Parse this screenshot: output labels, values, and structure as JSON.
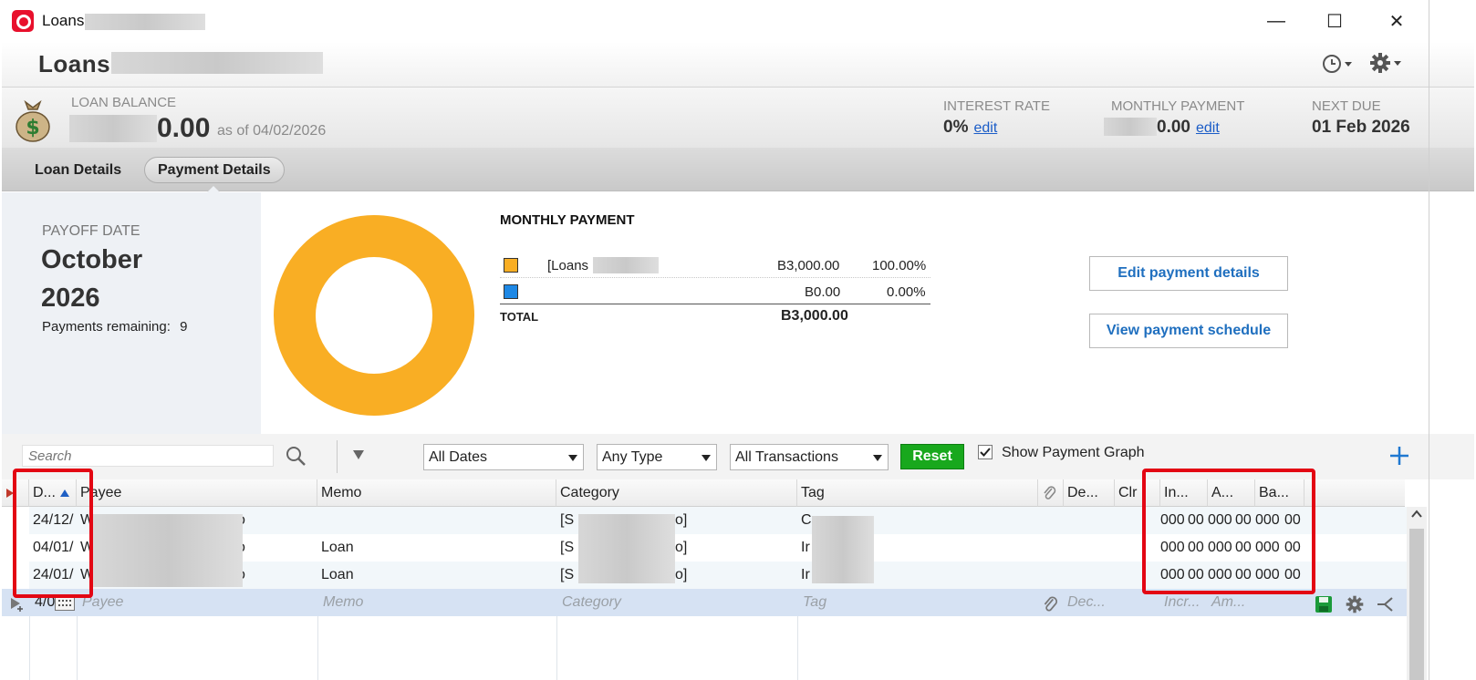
{
  "window": {
    "title": "Loans",
    "minimize_glyph": "—",
    "maximize_glyph": "☐",
    "close_glyph": "✕"
  },
  "header": {
    "title": "Loans",
    "icons": [
      "history-clock-icon",
      "gear-icon"
    ]
  },
  "summary": {
    "balance_label": "LOAN BALANCE",
    "balance_value": "0.00",
    "balance_asof": "as of 04/02/2026",
    "interest_label": "INTEREST RATE",
    "interest_value": "0%",
    "interest_edit": "edit",
    "payment_label": "MONTHLY PAYMENT",
    "payment_value": "0.00",
    "payment_edit": "edit",
    "nextdue_label": "NEXT DUE",
    "nextdue_value": "01 Feb 2026"
  },
  "tabs": [
    {
      "label": "Loan Details",
      "active": false
    },
    {
      "label": "Payment Details",
      "active": true
    }
  ],
  "payoff": {
    "label": "PAYOFF DATE",
    "month": "October",
    "year": "2026",
    "remaining_label": "Payments remaining:",
    "remaining_value": "9"
  },
  "monthly": {
    "title": "MONTHLY PAYMENT",
    "rows": [
      {
        "name": "[Loans",
        "amount": "B3,000.00",
        "percent": "100.00%",
        "color": "#f9ae24"
      },
      {
        "name": "",
        "amount": "B0.00",
        "percent": "0.00%",
        "color": "#1e88e5"
      }
    ],
    "total_label": "TOTAL",
    "total_amount": "B3,000.00"
  },
  "chart_data": {
    "type": "pie",
    "donut": true,
    "slices": [
      {
        "label": "[Loans",
        "value": 100.0,
        "color": "#f9ae24"
      },
      {
        "label": "",
        "value": 0.0,
        "color": "#1e88e5"
      }
    ]
  },
  "buttons": {
    "edit_payment": "Edit payment details",
    "view_schedule": "View payment schedule",
    "reset": "Reset"
  },
  "filters": {
    "search_placeholder": "Search",
    "dates": "All Dates",
    "type": "Any Type",
    "transactions": "All Transactions",
    "show_graph_label": "Show Payment Graph",
    "show_graph_checked": true
  },
  "register": {
    "columns": [
      "D...",
      "Payee",
      "Memo",
      "Category",
      "Tag",
      "De...",
      "Clr",
      "In...",
      "A...",
      "Ba..."
    ],
    "rows": [
      {
        "date": "24/12/",
        "payee": "W",
        "payee_end": "o",
        "memo": "",
        "category": "[S",
        "category_end": "o]",
        "tag": "C",
        "inc": "000",
        "inc2": "00",
        "amt": "000",
        "amt2": "00",
        "bal": "000",
        "bal2": "00"
      },
      {
        "date": "04/01/",
        "payee": "W",
        "payee_end": "o",
        "memo": "Loan",
        "category": "[S",
        "category_end": "o]",
        "tag": "Ir",
        "inc": "000",
        "inc2": "00",
        "amt": "000",
        "amt2": "00",
        "bal": "000",
        "bal2": "00"
      },
      {
        "date": "24/01/",
        "payee": "W",
        "payee_end": "o",
        "memo": "Loan",
        "category": "[S",
        "category_end": "o]",
        "tag": "Ir",
        "inc": "000",
        "inc2": "00",
        "amt": "000",
        "amt2": "00",
        "bal": "000",
        "bal2": "00"
      }
    ],
    "entry": {
      "date": "4/0",
      "payee": "Payee",
      "memo": "Memo",
      "category": "Category",
      "tag": "Tag",
      "dec": "Dec...",
      "inc": "Incr...",
      "amt": "Am..."
    }
  }
}
